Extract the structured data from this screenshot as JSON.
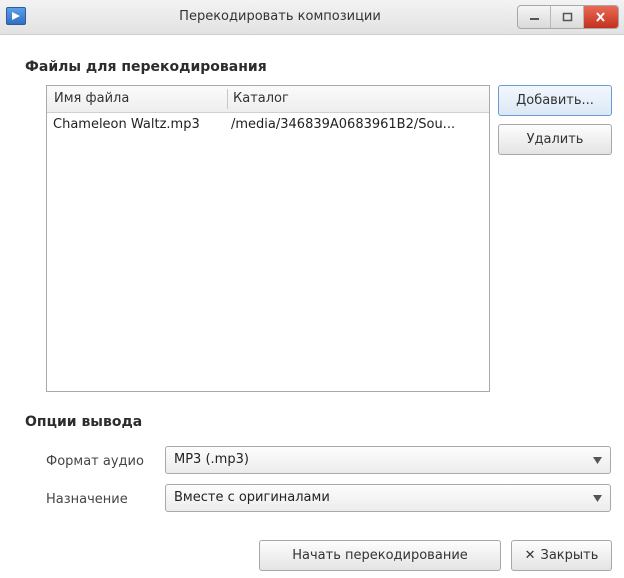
{
  "window": {
    "title": "Перекодировать композиции",
    "icon": "media-player-icon",
    "controls": [
      "minimize-icon",
      "maximize-icon",
      "close-icon"
    ]
  },
  "files_section": {
    "title": "Файлы для перекодирования",
    "columns": [
      "Имя файла",
      "Каталог"
    ],
    "rows": [
      {
        "filename": "Chameleon Waltz.mp3",
        "directory": "/media/346839A0683961B2/Sou..."
      }
    ],
    "add_button": "Добавить...",
    "remove_button": "Удалить"
  },
  "output_section": {
    "title": "Опции вывода",
    "format_label": "Формат аудио",
    "format_value": "MP3 (.mp3)",
    "destination_label": "Назначение",
    "destination_value": "Вместе с оригиналами"
  },
  "footer": {
    "start_button": "Начать перекодирование",
    "close_button": "Закрыть",
    "close_glyph": "✕"
  }
}
